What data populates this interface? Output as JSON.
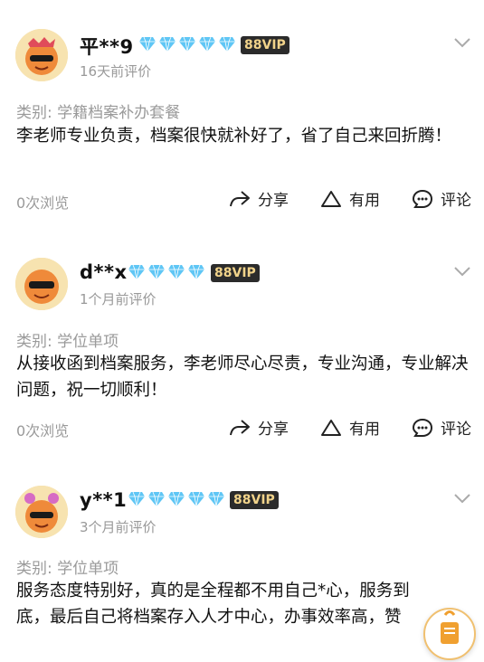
{
  "reviews": [
    {
      "username": "平**9",
      "diamond_count": 5,
      "vip": "88VIP",
      "time": "16天前评价",
      "category": "类别: 学籍档案补办套餐",
      "content": "李老师专业负责，档案很快就补好了，省了自己来回折腾！",
      "views": "0次浏览",
      "actions": {
        "share": "分享",
        "useful": "有用",
        "comment": "评论"
      }
    },
    {
      "username": "d**x",
      "diamond_count": 4,
      "vip": "88VIP",
      "time": "1个月前评价",
      "category": "类别: 学位单项",
      "content": "从接收函到档案服务，李老师尽心尽责，专业沟通，专业解决问题，祝一切顺利！",
      "views": "0次浏览",
      "actions": {
        "share": "分享",
        "useful": "有用",
        "comment": "评论"
      }
    },
    {
      "username": "y**1",
      "diamond_count": 5,
      "vip": "88VIP",
      "time": "3个月前评价",
      "category": "类别: 学位单项",
      "content": "服务态度特别好，真的是全程都不用自己*心，服务到底，最后自己将档案存入人才中心，办事效率高，赞",
      "views": "",
      "actions": {
        "share": "",
        "useful": "",
        "comment": ""
      }
    }
  ],
  "colors": {
    "diamond": "#5fc6f5",
    "vip_bg": "#2b2b2b",
    "vip_text": "#f1d38a",
    "muted": "#9a9a9a"
  },
  "icons": {
    "share": "share-arrow-icon",
    "useful": "triangle-useful-icon",
    "comment": "comment-bubble-icon",
    "expand": "chevron-down-icon"
  }
}
